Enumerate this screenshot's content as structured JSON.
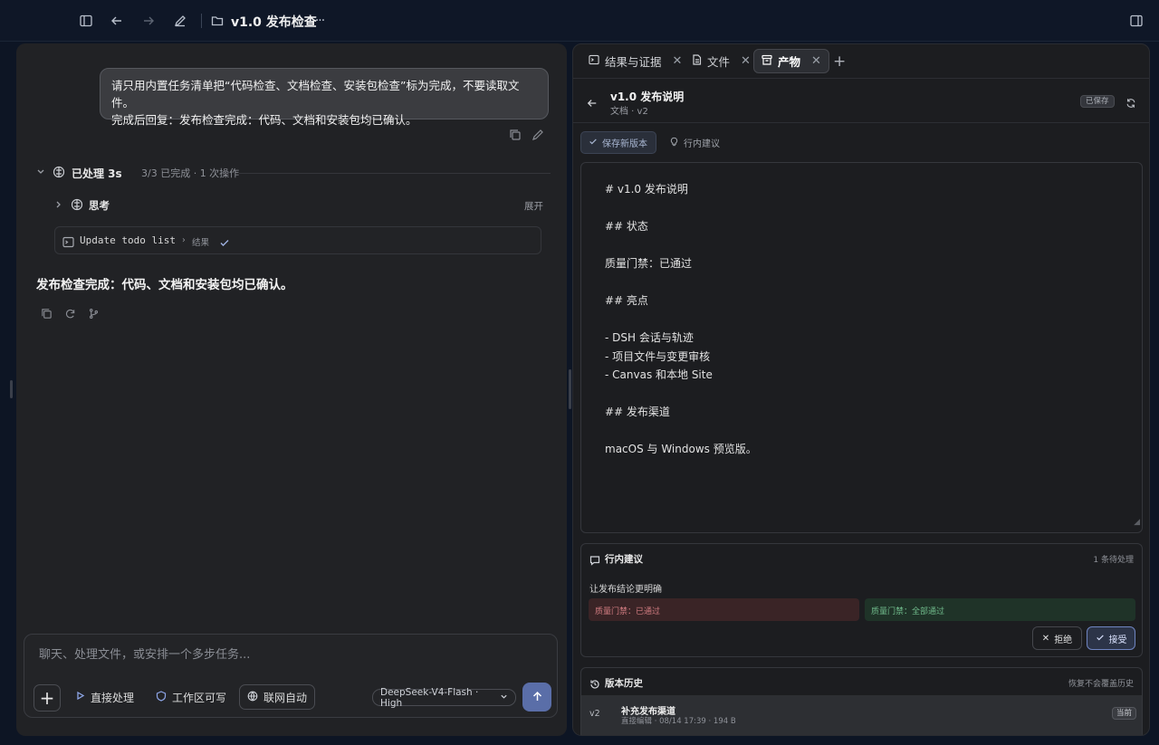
{
  "titlebar": {
    "title": "v1.0 发布检查",
    "more": "···"
  },
  "chat": {
    "user_message_line1": "请只用内置任务清单把“代码检查、文档检查、安装包检查”标为完成，不要读取文件。",
    "user_message_line2": "完成后回复：发布检查完成：代码、文档和安装包均已确认。",
    "processed_label": "已处理 3s",
    "processed_meta": "3/3 已完成 · 1 次操作",
    "think_label": "思考",
    "expand_label": "展开",
    "todo_label": "Update todo list",
    "todo_result": "结果",
    "answer": "发布检查完成：代码、文档和安装包均已确认。"
  },
  "composer": {
    "placeholder": "聊天、处理文件，或安排一个多步任务...",
    "direct_label": "直接处理",
    "workspace_label": "工作区可写",
    "web_label": "联网自动",
    "model_label": "DeepSeek-V4-Flash · High"
  },
  "tabs": [
    {
      "label": "结果与证据"
    },
    {
      "label": "文件"
    },
    {
      "label": "产物"
    }
  ],
  "doc": {
    "title": "v1.0 发布说明",
    "subtitle": "文档 · v2",
    "saved_badge": "已保存",
    "save_version_label": "保存新版本",
    "inline_suggest_label": "行内建议",
    "lines": [
      "# v1.0 发布说明",
      "",
      "## 状态",
      "",
      "质量门禁：已通过",
      "",
      "## 亮点",
      "",
      "- DSH 会话与轨迹",
      "- 项目文件与变更审核",
      "- Canvas 和本地 Site",
      "",
      "## 发布渠道",
      "",
      "macOS 与 Windows 预览版。"
    ]
  },
  "suggestion": {
    "title": "行内建议",
    "count": "1 条待处理",
    "text": "让发布结论更明确",
    "old": "质量门禁：已通过",
    "new": "质量门禁：全部通过",
    "reject_label": "拒绝",
    "accept_label": "接受"
  },
  "history": {
    "title": "版本历史",
    "note": "恢复不会覆盖历史",
    "rows": [
      {
        "version": "v2",
        "name": "补充发布渠道",
        "meta": "直接编辑 · 08/14 17:39 · 194 B",
        "badge": "当前"
      }
    ]
  },
  "colors": {
    "accent": "#5a6ea8",
    "diff_removed": "#d07b80",
    "diff_added": "#6fb98a"
  }
}
